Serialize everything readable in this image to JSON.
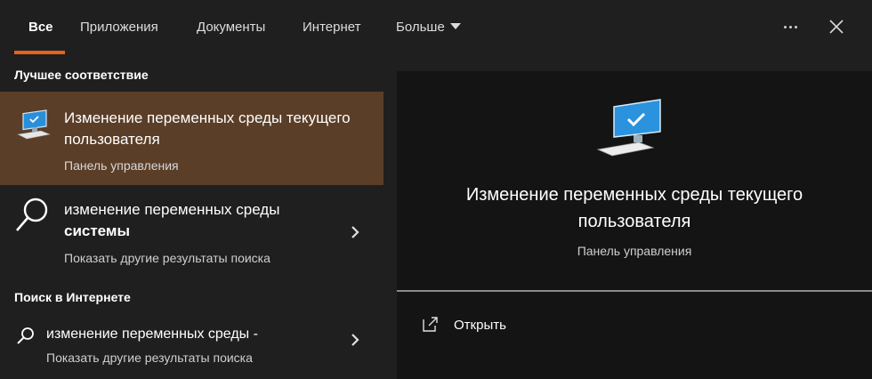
{
  "tabs": [
    {
      "label": "Все",
      "active": true
    },
    {
      "label": "Приложения"
    },
    {
      "label": "Документы"
    },
    {
      "label": "Интернет"
    },
    {
      "label": "Больше"
    }
  ],
  "accent_color": "#e5631a",
  "selected_item_bg": "#5a3e28",
  "left": {
    "best_match_header": "Лучшее соответствие",
    "best_match": {
      "icon": "computer-check-icon",
      "title": "Изменение переменных среды текущего пользователя",
      "subtitle": "Панель управления"
    },
    "system_result": {
      "icon": "search-icon",
      "title_prefix": "изменение переменных среды",
      "title_bold": "системы",
      "subtitle": "Показать другие результаты поиска"
    },
    "web_header": "Поиск в Интернете",
    "web_result": {
      "icon": "search-icon",
      "title": "изменение переменных среды -",
      "subtitle": "Показать другие результаты поиска"
    }
  },
  "preview": {
    "icon": "computer-check-icon",
    "title": "Изменение переменных среды текущего пользователя",
    "subtitle": "Панель управления",
    "actions": [
      {
        "icon": "open-icon",
        "label": "Открыть"
      }
    ]
  }
}
